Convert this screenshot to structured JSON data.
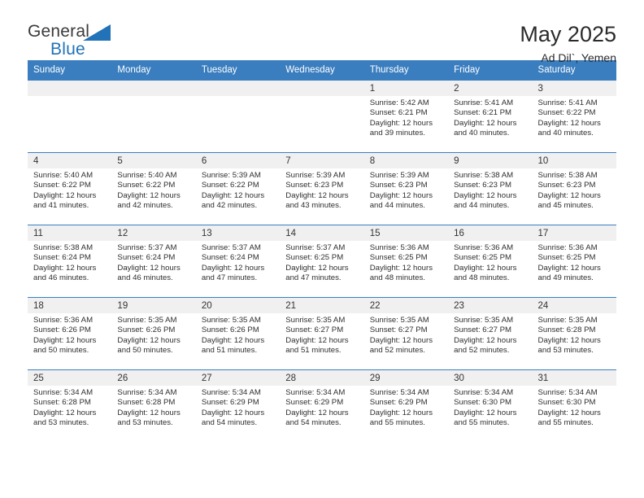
{
  "brand": {
    "name_top": "General",
    "name_bottom": "Blue",
    "accent_color": "#2272b8"
  },
  "header": {
    "title": "May 2025",
    "subtitle": "Ad Dil`, Yemen"
  },
  "calendar": {
    "header_bg": "#3a7ebf",
    "daynum_bg": "#f0f0f0",
    "weekday_headers": [
      "Sunday",
      "Monday",
      "Tuesday",
      "Wednesday",
      "Thursday",
      "Friday",
      "Saturday"
    ],
    "labels": {
      "sunrise": "Sunrise:",
      "sunset": "Sunset:",
      "daylight": "Daylight:"
    },
    "weeks": [
      [
        {
          "day": "",
          "blank": true,
          "sunrise": "",
          "sunset": "",
          "daylight": ""
        },
        {
          "day": "",
          "blank": true,
          "sunrise": "",
          "sunset": "",
          "daylight": ""
        },
        {
          "day": "",
          "blank": true,
          "sunrise": "",
          "sunset": "",
          "daylight": ""
        },
        {
          "day": "",
          "blank": true,
          "sunrise": "",
          "sunset": "",
          "daylight": ""
        },
        {
          "day": "1",
          "sunrise": "Sunrise: 5:42 AM",
          "sunset": "Sunset: 6:21 PM",
          "daylight": "Daylight: 12 hours and 39 minutes."
        },
        {
          "day": "2",
          "sunrise": "Sunrise: 5:41 AM",
          "sunset": "Sunset: 6:21 PM",
          "daylight": "Daylight: 12 hours and 40 minutes."
        },
        {
          "day": "3",
          "sunrise": "Sunrise: 5:41 AM",
          "sunset": "Sunset: 6:22 PM",
          "daylight": "Daylight: 12 hours and 40 minutes."
        }
      ],
      [
        {
          "day": "4",
          "sunrise": "Sunrise: 5:40 AM",
          "sunset": "Sunset: 6:22 PM",
          "daylight": "Daylight: 12 hours and 41 minutes."
        },
        {
          "day": "5",
          "sunrise": "Sunrise: 5:40 AM",
          "sunset": "Sunset: 6:22 PM",
          "daylight": "Daylight: 12 hours and 42 minutes."
        },
        {
          "day": "6",
          "sunrise": "Sunrise: 5:39 AM",
          "sunset": "Sunset: 6:22 PM",
          "daylight": "Daylight: 12 hours and 42 minutes."
        },
        {
          "day": "7",
          "sunrise": "Sunrise: 5:39 AM",
          "sunset": "Sunset: 6:23 PM",
          "daylight": "Daylight: 12 hours and 43 minutes."
        },
        {
          "day": "8",
          "sunrise": "Sunrise: 5:39 AM",
          "sunset": "Sunset: 6:23 PM",
          "daylight": "Daylight: 12 hours and 44 minutes."
        },
        {
          "day": "9",
          "sunrise": "Sunrise: 5:38 AM",
          "sunset": "Sunset: 6:23 PM",
          "daylight": "Daylight: 12 hours and 44 minutes."
        },
        {
          "day": "10",
          "sunrise": "Sunrise: 5:38 AM",
          "sunset": "Sunset: 6:23 PM",
          "daylight": "Daylight: 12 hours and 45 minutes."
        }
      ],
      [
        {
          "day": "11",
          "sunrise": "Sunrise: 5:38 AM",
          "sunset": "Sunset: 6:24 PM",
          "daylight": "Daylight: 12 hours and 46 minutes."
        },
        {
          "day": "12",
          "sunrise": "Sunrise: 5:37 AM",
          "sunset": "Sunset: 6:24 PM",
          "daylight": "Daylight: 12 hours and 46 minutes."
        },
        {
          "day": "13",
          "sunrise": "Sunrise: 5:37 AM",
          "sunset": "Sunset: 6:24 PM",
          "daylight": "Daylight: 12 hours and 47 minutes."
        },
        {
          "day": "14",
          "sunrise": "Sunrise: 5:37 AM",
          "sunset": "Sunset: 6:25 PM",
          "daylight": "Daylight: 12 hours and 47 minutes."
        },
        {
          "day": "15",
          "sunrise": "Sunrise: 5:36 AM",
          "sunset": "Sunset: 6:25 PM",
          "daylight": "Daylight: 12 hours and 48 minutes."
        },
        {
          "day": "16",
          "sunrise": "Sunrise: 5:36 AM",
          "sunset": "Sunset: 6:25 PM",
          "daylight": "Daylight: 12 hours and 48 minutes."
        },
        {
          "day": "17",
          "sunrise": "Sunrise: 5:36 AM",
          "sunset": "Sunset: 6:25 PM",
          "daylight": "Daylight: 12 hours and 49 minutes."
        }
      ],
      [
        {
          "day": "18",
          "sunrise": "Sunrise: 5:36 AM",
          "sunset": "Sunset: 6:26 PM",
          "daylight": "Daylight: 12 hours and 50 minutes."
        },
        {
          "day": "19",
          "sunrise": "Sunrise: 5:35 AM",
          "sunset": "Sunset: 6:26 PM",
          "daylight": "Daylight: 12 hours and 50 minutes."
        },
        {
          "day": "20",
          "sunrise": "Sunrise: 5:35 AM",
          "sunset": "Sunset: 6:26 PM",
          "daylight": "Daylight: 12 hours and 51 minutes."
        },
        {
          "day": "21",
          "sunrise": "Sunrise: 5:35 AM",
          "sunset": "Sunset: 6:27 PM",
          "daylight": "Daylight: 12 hours and 51 minutes."
        },
        {
          "day": "22",
          "sunrise": "Sunrise: 5:35 AM",
          "sunset": "Sunset: 6:27 PM",
          "daylight": "Daylight: 12 hours and 52 minutes."
        },
        {
          "day": "23",
          "sunrise": "Sunrise: 5:35 AM",
          "sunset": "Sunset: 6:27 PM",
          "daylight": "Daylight: 12 hours and 52 minutes."
        },
        {
          "day": "24",
          "sunrise": "Sunrise: 5:35 AM",
          "sunset": "Sunset: 6:28 PM",
          "daylight": "Daylight: 12 hours and 53 minutes."
        }
      ],
      [
        {
          "day": "25",
          "sunrise": "Sunrise: 5:34 AM",
          "sunset": "Sunset: 6:28 PM",
          "daylight": "Daylight: 12 hours and 53 minutes."
        },
        {
          "day": "26",
          "sunrise": "Sunrise: 5:34 AM",
          "sunset": "Sunset: 6:28 PM",
          "daylight": "Daylight: 12 hours and 53 minutes."
        },
        {
          "day": "27",
          "sunrise": "Sunrise: 5:34 AM",
          "sunset": "Sunset: 6:29 PM",
          "daylight": "Daylight: 12 hours and 54 minutes."
        },
        {
          "day": "28",
          "sunrise": "Sunrise: 5:34 AM",
          "sunset": "Sunset: 6:29 PM",
          "daylight": "Daylight: 12 hours and 54 minutes."
        },
        {
          "day": "29",
          "sunrise": "Sunrise: 5:34 AM",
          "sunset": "Sunset: 6:29 PM",
          "daylight": "Daylight: 12 hours and 55 minutes."
        },
        {
          "day": "30",
          "sunrise": "Sunrise: 5:34 AM",
          "sunset": "Sunset: 6:30 PM",
          "daylight": "Daylight: 12 hours and 55 minutes."
        },
        {
          "day": "31",
          "sunrise": "Sunrise: 5:34 AM",
          "sunset": "Sunset: 6:30 PM",
          "daylight": "Daylight: 12 hours and 55 minutes."
        }
      ]
    ]
  }
}
